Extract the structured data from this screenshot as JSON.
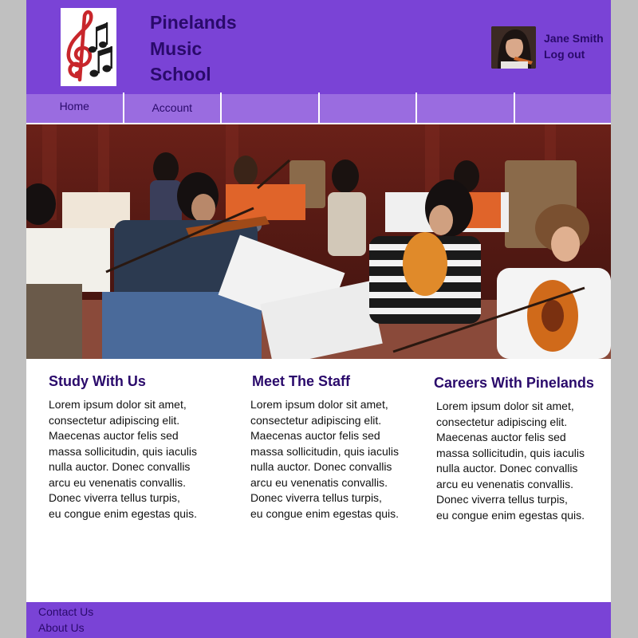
{
  "header": {
    "logo_icon": "treble-clef-music-notes-icon",
    "title_lines": [
      "Pinelands",
      "Music",
      "School"
    ],
    "user": {
      "name": "Jane Smith",
      "logout_label": "Log out"
    }
  },
  "nav": {
    "items": [
      {
        "label": "Home"
      },
      {
        "label": "Account"
      },
      {
        "label": ""
      },
      {
        "label": ""
      },
      {
        "label": ""
      },
      {
        "label": ""
      }
    ]
  },
  "hero": {
    "image": "students-playing-violins-photo"
  },
  "columns": [
    {
      "title": "Study With Us",
      "body": "Lorem ipsum dolor sit amet,\nconsectetur adipiscing elit.\nMaecenas auctor felis sed\nmassa sollicitudin, quis iaculis\nnulla auctor. Donec convallis\narcu eu venenatis convallis.\nDonec viverra tellus turpis,\neu congue enim egestas quis."
    },
    {
      "title": "Meet The Staff",
      "body": "Lorem ipsum dolor sit amet,\nconsectetur adipiscing elit.\nMaecenas auctor felis sed\nmassa sollicitudin, quis iaculis\nnulla auctor. Donec convallis\narcu eu venenatis convallis.\nDonec viverra tellus turpis,\neu congue enim egestas quis."
    },
    {
      "title": "Careers With Pinelands",
      "body": "Lorem ipsum dolor sit amet,\nconsectetur adipiscing elit.\nMaecenas auctor felis sed\nmassa sollicitudin, quis iaculis\nnulla auctor. Donec convallis\narcu eu venenatis convallis.\nDonec viverra tellus turpis,\neu congue enim egestas quis."
    }
  ],
  "footer": {
    "links": [
      {
        "label": "Contact Us"
      },
      {
        "label": "About Us"
      }
    ]
  },
  "colors": {
    "header_bg": "#7a43d6",
    "nav_bg": "#9a6ce0",
    "heading_text": "#2a0a6b",
    "page_bg": "#c0c0c0"
  }
}
